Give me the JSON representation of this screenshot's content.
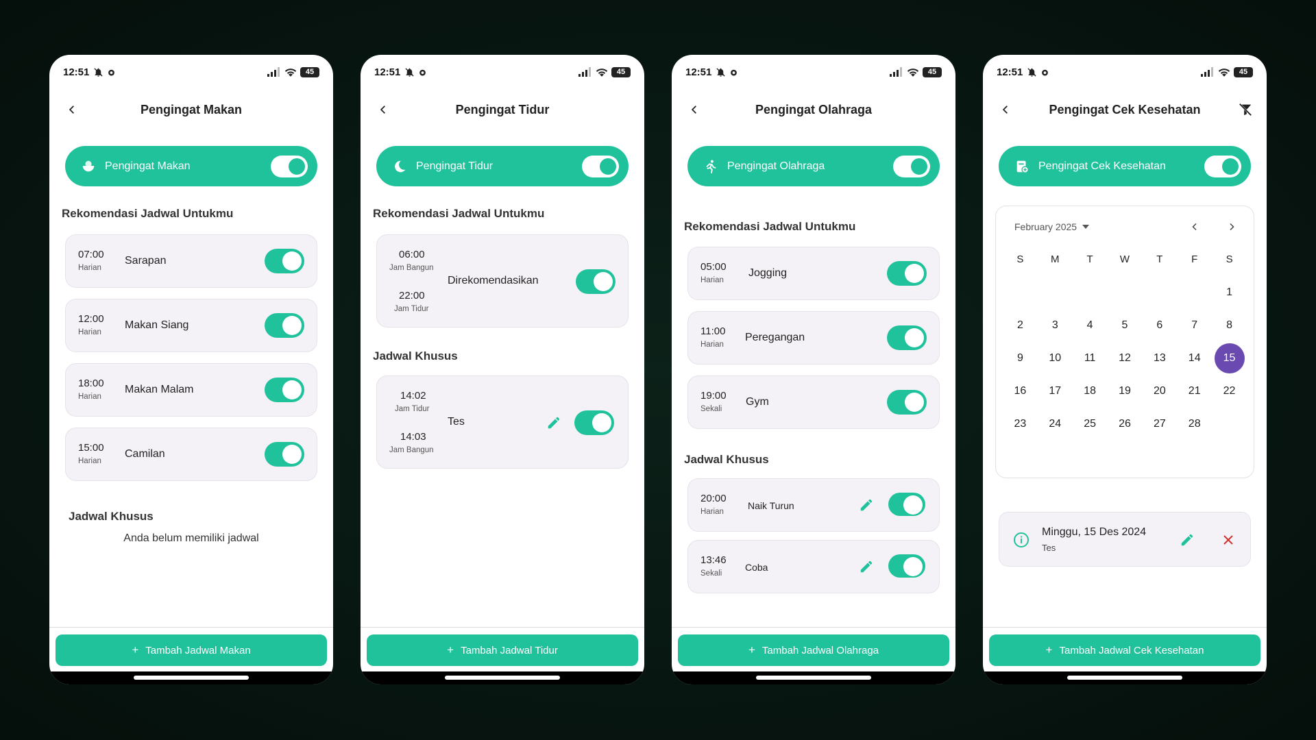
{
  "status": {
    "time": "12:51",
    "battery": "45"
  },
  "colors": {
    "accent": "#20c29c",
    "selected_day": "#6a4ab0",
    "delete": "#d32f2f"
  },
  "screens": {
    "makan": {
      "title": "Pengingat Makan",
      "pill_label": "Pengingat Makan",
      "recommend_title": "Rekomendasi Jadwal Untukmu",
      "items": [
        {
          "time": "07:00",
          "freq": "Harian",
          "label": "Sarapan"
        },
        {
          "time": "12:00",
          "freq": "Harian",
          "label": "Makan Siang"
        },
        {
          "time": "18:00",
          "freq": "Harian",
          "label": "Makan Malam"
        },
        {
          "time": "15:00",
          "freq": "Harian",
          "label": "Camilan"
        }
      ],
      "special_title": "Jadwal Khusus",
      "empty_text": "Anda belum memiliki jadwal",
      "add_button": "Tambah Jadwal Makan"
    },
    "tidur": {
      "title": "Pengingat Tidur",
      "pill_label": "Pengingat Tidur",
      "recommend_title": "Rekomendasi Jadwal Untukmu",
      "recommended": {
        "time1": "06:00",
        "sub1": "Jam Bangun",
        "time2": "22:00",
        "sub2": "Jam Tidur",
        "label": "Direkomendasikan"
      },
      "special_title": "Jadwal Khusus",
      "special": {
        "time1": "14:02",
        "sub1": "Jam Tidur",
        "time2": "14:03",
        "sub2": "Jam Bangun",
        "label": "Tes"
      },
      "add_button": "Tambah Jadwal Tidur"
    },
    "olahraga": {
      "title": "Pengingat Olahraga",
      "pill_label": "Pengingat Olahraga",
      "recommend_title": "Rekomendasi Jadwal Untukmu",
      "items": [
        {
          "time": "05:00",
          "freq": "Harian",
          "label": "Jogging"
        },
        {
          "time": "11:00",
          "freq": "Harian",
          "label": "Peregangan"
        },
        {
          "time": "19:00",
          "freq": "Sekali",
          "label": "Gym"
        }
      ],
      "special_title": "Jadwal Khusus",
      "special": [
        {
          "time": "20:00",
          "freq": "Harian",
          "label": "Naik Turun"
        },
        {
          "time": "13:46",
          "freq": "Sekali",
          "label": "Coba"
        }
      ],
      "add_button": "Tambah Jadwal Olahraga"
    },
    "cek": {
      "title": "Pengingat Cek Kesehatan",
      "pill_label": "Pengingat Cek Kesehatan",
      "calendar": {
        "month": "February 2025",
        "weekdays": [
          "S",
          "M",
          "T",
          "W",
          "T",
          "F",
          "S"
        ],
        "selected": "15"
      },
      "event": {
        "title": "Minggu, 15 Des 2024",
        "sub": "Tes"
      },
      "add_button": "Tambah Jadwal Cek Kesehatan"
    }
  }
}
